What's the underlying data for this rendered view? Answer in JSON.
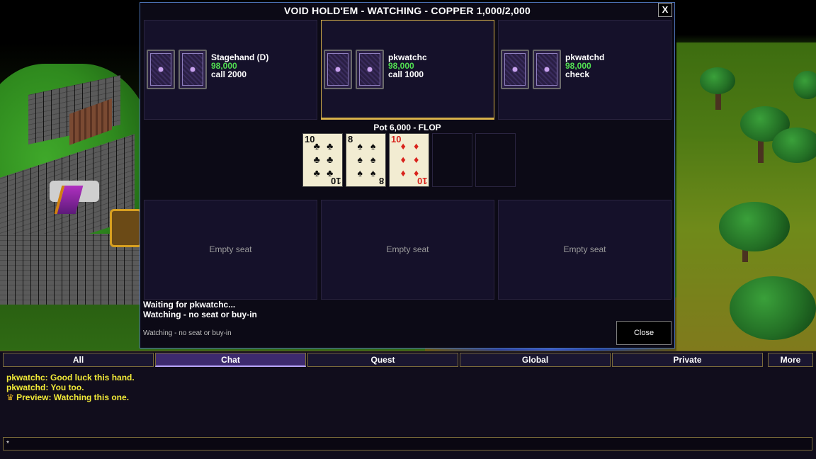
{
  "window": {
    "title": "VOID HOLD'EM - WATCHING - COPPER 1,000/2,000",
    "close_x": "X"
  },
  "seats": [
    {
      "name": "Stagehand (D)",
      "chips": "98,000",
      "action": "call 2000",
      "active": false
    },
    {
      "name": "pkwatchc",
      "chips": "98,000",
      "action": "call 1000",
      "active": true
    },
    {
      "name": "pkwatchd",
      "chips": "98,000",
      "action": "check",
      "active": false
    }
  ],
  "empty_seats": [
    "Empty seat",
    "Empty seat",
    "Empty seat"
  ],
  "pot": {
    "label": "Pot 6,000  -  FLOP"
  },
  "board": [
    {
      "rank": "10",
      "suit": "clubs",
      "suit_glyph": "♣",
      "color": "black"
    },
    {
      "rank": "8",
      "suit": "spades",
      "suit_glyph": "♠",
      "color": "black"
    },
    {
      "rank": "10",
      "suit": "diamonds",
      "suit_glyph": "♦",
      "color": "red"
    }
  ],
  "status": {
    "line1": "Waiting for pkwatchc...",
    "line2": "Watching - no seat or buy-in",
    "footer": "Watching - no seat or buy-in"
  },
  "close_button": "Close",
  "chat": {
    "tabs": [
      {
        "label": "All",
        "active": false
      },
      {
        "label": "Chat",
        "active": true
      },
      {
        "label": "Quest",
        "active": false
      },
      {
        "label": "Global",
        "active": false
      },
      {
        "label": "Private",
        "active": false
      },
      {
        "label": "More",
        "active": false
      }
    ],
    "messages": [
      "pkwatchc: Good luck this hand.",
      "pkwatchd: You too.",
      "Preview: Watching this one."
    ],
    "input_value": "*"
  },
  "colors": {
    "accent": "#d9b24a",
    "chips": "#52e052",
    "chat_text": "#f2ea38",
    "tab_active": "#3d2a6e"
  }
}
